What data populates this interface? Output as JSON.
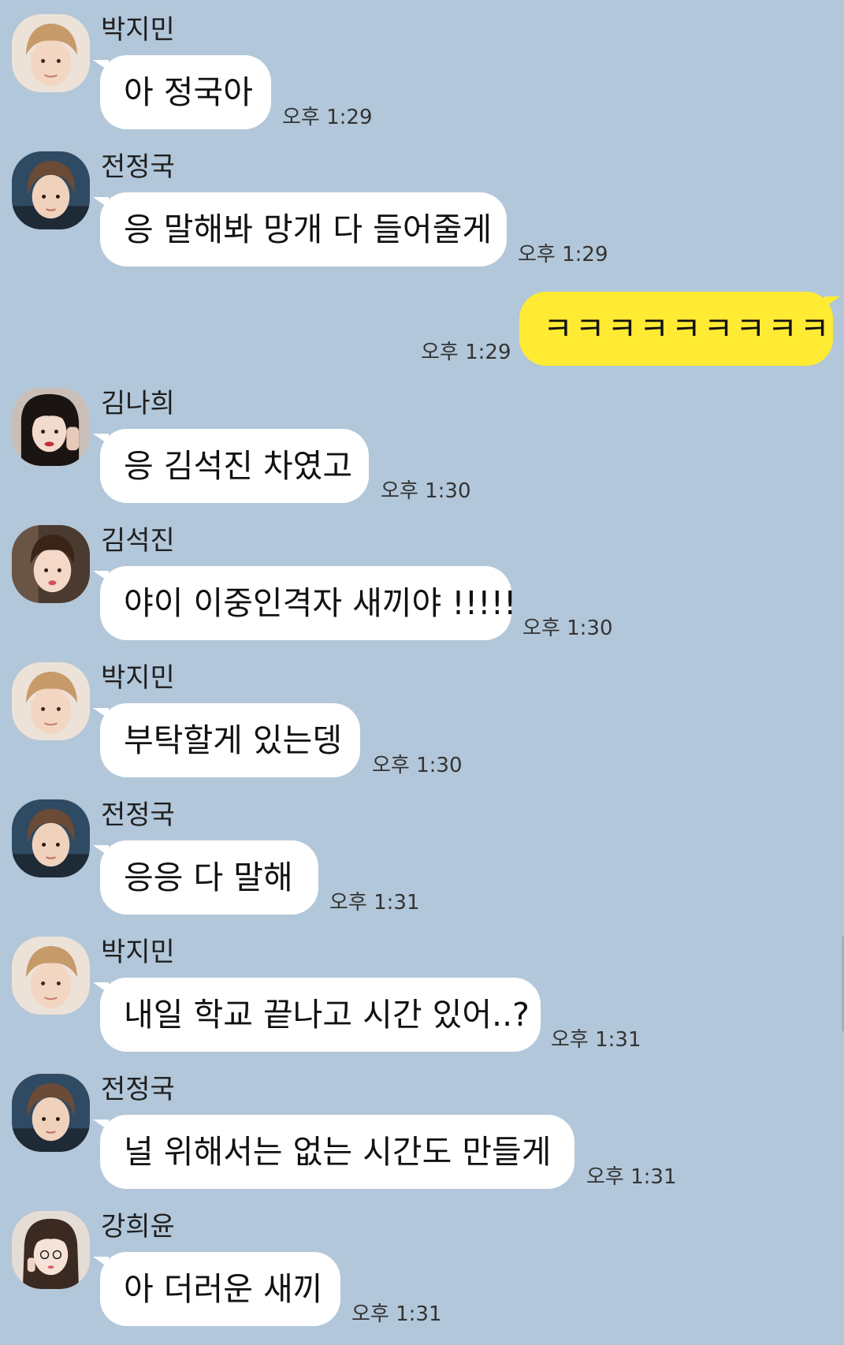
{
  "messages": [
    {
      "sender": "박지민",
      "text": "아 정국아",
      "time": "오후 1:29",
      "avatar": "avatar-jimin"
    },
    {
      "sender": "전정국",
      "text": "응 말해봐 망개 다 들어줄게",
      "time": "오후 1:29",
      "avatar": "avatar-jungkook"
    },
    {
      "sender": "",
      "text": "ㅋㅋㅋㅋㅋㅋㅋㅋㅋ",
      "time": "오후 1:29",
      "mine": true
    },
    {
      "sender": "김나희",
      "text": "응 김석진 차였고",
      "time": "오후 1:30",
      "avatar": "avatar-nahee"
    },
    {
      "sender": "김석진",
      "text": "야이 이중인격자 새끼야 !!!!!",
      "time": "오후 1:30",
      "avatar": "avatar-seokjin"
    },
    {
      "sender": "박지민",
      "text": "부탁할게 있는뎅",
      "time": "오후 1:30",
      "avatar": "avatar-jimin"
    },
    {
      "sender": "전정국",
      "text": "응응 다 말해",
      "time": "오후 1:31",
      "avatar": "avatar-jungkook"
    },
    {
      "sender": "박지민",
      "text": "내일 학교 끝나고 시간 있어..?",
      "time": "오후 1:31",
      "avatar": "avatar-jimin"
    },
    {
      "sender": "전정국",
      "text": "널 위해서는 없는 시간도 만들게",
      "time": "오후 1:31",
      "avatar": "avatar-jungkook"
    },
    {
      "sender": "강희윤",
      "text": "아 더러운 새끼",
      "time": "오후 1:31",
      "avatar": "avatar-heeyoon"
    }
  ],
  "colors": {
    "background": "#b2c7d9",
    "my_bubble": "#ffeb33",
    "their_bubble": "#ffffff"
  }
}
